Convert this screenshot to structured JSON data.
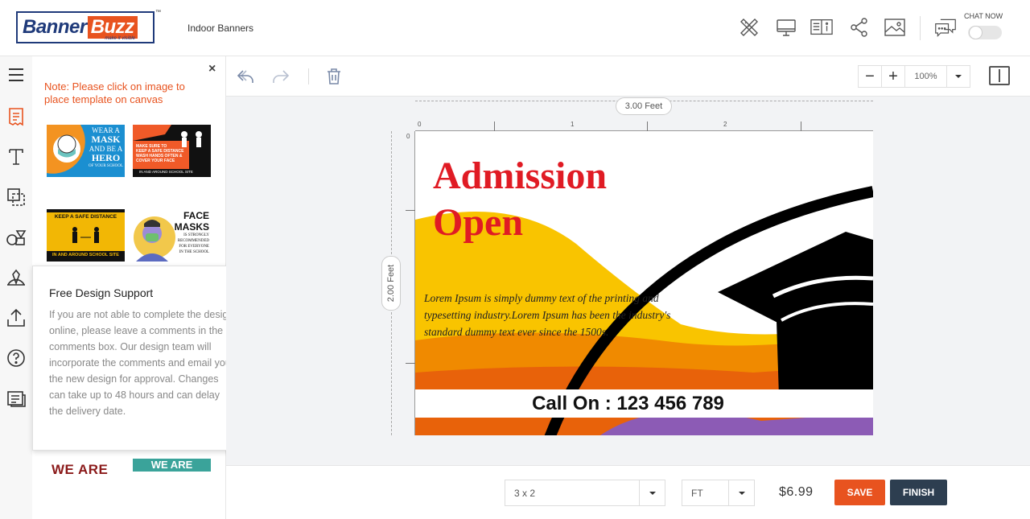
{
  "brand": {
    "name_part1": "Banner",
    "name_part2": "Buzz",
    "tagline": "make it visible",
    "trademark": "™"
  },
  "header": {
    "product_name": "Indoor Banners",
    "icons": [
      "design-tools-icon",
      "preview-monitor-icon",
      "product-info-icon",
      "share-icon",
      "image-gallery-icon",
      "chat-icon"
    ],
    "chat_label": "CHAT NOW",
    "chat_toggle_on": false
  },
  "rail": {
    "items": [
      "menu-icon",
      "templates-icon",
      "text-icon",
      "shapes-layers-icon",
      "clipart-icon",
      "background-icon",
      "upload-icon",
      "help-icon",
      "comments-icon"
    ]
  },
  "panel": {
    "close": "×",
    "note": "Note: Please click on image to place template on canvas",
    "templates": [
      {
        "lines": [
          "WEAR A",
          "MASK",
          "AND BE A",
          "HERO",
          "OF YOUR SCHOOL"
        ]
      },
      {
        "lines": [
          "MAKE SURE TO",
          "KEEP A SAFE DISTANCE",
          "WASH HANDS OFTEN &",
          "COVER YOUR FACE",
          "IN AND AROUND SCHOOL SITE"
        ]
      },
      {
        "lines": [
          "KEEP A SAFE DISTANCE",
          "IN AND AROUND SCHOOL SITE"
        ]
      },
      {
        "lines": [
          "FACE",
          "MASKS",
          "IS STRONGLY",
          "RECOMMENDED",
          "FOR EVERYONE",
          "IN THE SCHOOL"
        ]
      },
      {
        "lines": [
          "WE ARE"
        ]
      },
      {
        "lines": [
          "WE ARE"
        ]
      }
    ]
  },
  "support": {
    "title": "Free Design Support",
    "close": "×",
    "body": "If you are not able to complete the design online, please leave a comments in the comments box. Our design team will incorporate the comments and email you the new design for approval. Changes can take up to 48 hours and can delay the delivery date."
  },
  "toolbar": {
    "undo": "undo-icon",
    "redo": "redo-icon",
    "delete": "trash-icon",
    "zoom_value": "100%",
    "zoom_minus": "−",
    "zoom_plus": "+"
  },
  "canvas": {
    "width_label": "3.00 Feet",
    "height_label": "2.00 Feet",
    "ruler_top": [
      "0",
      "1",
      "2"
    ],
    "ruler_left": [
      "0"
    ],
    "headline_line1": "Admission",
    "headline_line2": "Open",
    "lorem": "Lorem Ipsum is simply dummy text of the printing and typesetting industry.Lorem Ipsum has  been the industry's standard dummy text ever since the 1500s.",
    "call_text": "Call On : 123 456 789",
    "colors": {
      "headline": "#e01b24",
      "yellow": "#f9c400",
      "orange": "#f08a00",
      "cap": "#000000"
    }
  },
  "bottom": {
    "size_value": "3 x 2",
    "unit_value": "FT",
    "price": "$6.99",
    "save_label": "SAVE",
    "finish_label": "FINISH"
  }
}
